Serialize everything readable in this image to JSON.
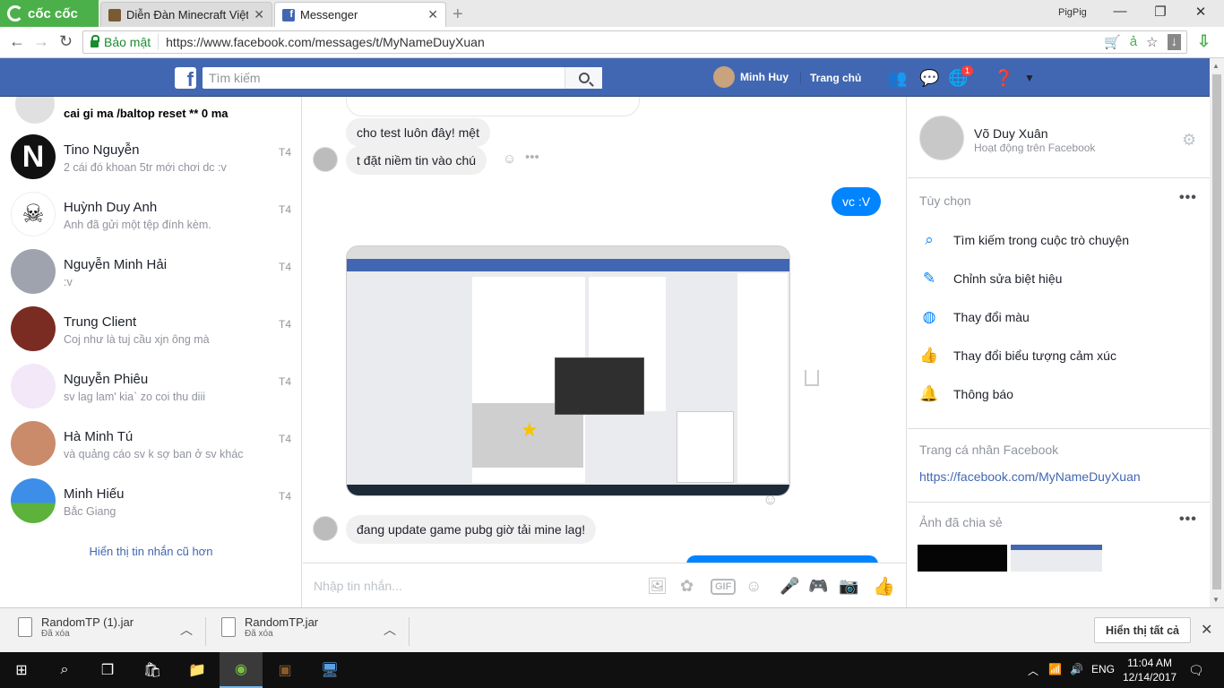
{
  "browser": {
    "brand": "cốc cốc",
    "tabs": [
      {
        "label": "Diễn Đàn Minecraft Việt Na",
        "active": false
      },
      {
        "label": "Messenger",
        "active": true
      }
    ],
    "new_tab_icon": "plus-icon",
    "profile_name": "PigPig",
    "secure_label": "Bảo mật",
    "url": "https://www.facebook.com/messages/t/MyNameDuyXuan"
  },
  "fb_header": {
    "search_placeholder": "Tìm kiếm",
    "user_name": "Minh Huy",
    "home_label": "Trang chủ",
    "notification_count": "1",
    "brand_color": "#4267b2"
  },
  "conversations": {
    "top_partial_message": "cai gi ma /baltop reset ** 0 ma",
    "items": [
      {
        "name": "Tino Nguyễn",
        "preview": "2 cái đó khoan 5tr mới chơi dc :v",
        "date": "T4"
      },
      {
        "name": "Huỳnh Duy Anh",
        "preview": "Anh đã gửi một tệp đính kèm.",
        "date": "T4"
      },
      {
        "name": "Nguyễn Minh Hải",
        "preview": ":v",
        "date": "T4"
      },
      {
        "name": "Trung Client",
        "preview": "Coj như là tuj cầu xjn ông mà",
        "date": "T4"
      },
      {
        "name": "Nguyễn Phiêu",
        "preview": "sv lag lam' kia` zo coi thu diii",
        "date": "T4"
      },
      {
        "name": "Hà Minh Tú",
        "preview": "và quảng cáo sv k sợ ban ở sv khác",
        "date": "T4"
      },
      {
        "name": "Minh Hiếu",
        "preview": "Bắc Giang",
        "date": "T4"
      }
    ],
    "older_link": "Hiển thị tin nhắn cũ hơn"
  },
  "chat": {
    "messages": [
      {
        "text": "cho test luôn đây! mệt",
        "mine": false
      },
      {
        "text": "t đặt niềm tin vào chú",
        "mine": false
      },
      {
        "text": "vc :V",
        "mine": true
      },
      {
        "text": "đang update game pubg giờ tải mine lag!",
        "mine": false
      }
    ],
    "composer_placeholder": "Nhập tin nhắn...",
    "gif_label": "GIF",
    "accent_color": "#0084ff"
  },
  "info_panel": {
    "name": "Võ Duy Xuân",
    "status": "Hoạt động trên Facebook",
    "options_header": "Tùy chọn",
    "options": [
      {
        "label": "Tìm kiếm trong cuộc trò chuyện",
        "icon": "search-icon"
      },
      {
        "label": "Chỉnh sửa biệt hiệu",
        "icon": "pencil-icon"
      },
      {
        "label": "Thay đổi màu",
        "icon": "palette-icon"
      },
      {
        "label": "Thay đổi biểu tượng cảm xúc",
        "icon": "thumbs-up-icon"
      },
      {
        "label": "Thông báo",
        "icon": "bell-icon"
      }
    ],
    "profile_header": "Trang cá nhân Facebook",
    "profile_url": "https://facebook.com/MyNameDuyXuan",
    "shared_photos_header": "Ảnh đã chia sẻ"
  },
  "downloads": {
    "items": [
      {
        "name": "RandomTP (1).jar",
        "status": "Đã xóa"
      },
      {
        "name": "RandomTP.jar",
        "status": "Đã xóa"
      }
    ],
    "show_all": "Hiển thị tất cả"
  },
  "taskbar": {
    "language": "ENG",
    "time": "11:04 AM",
    "date": "12/14/2017"
  }
}
